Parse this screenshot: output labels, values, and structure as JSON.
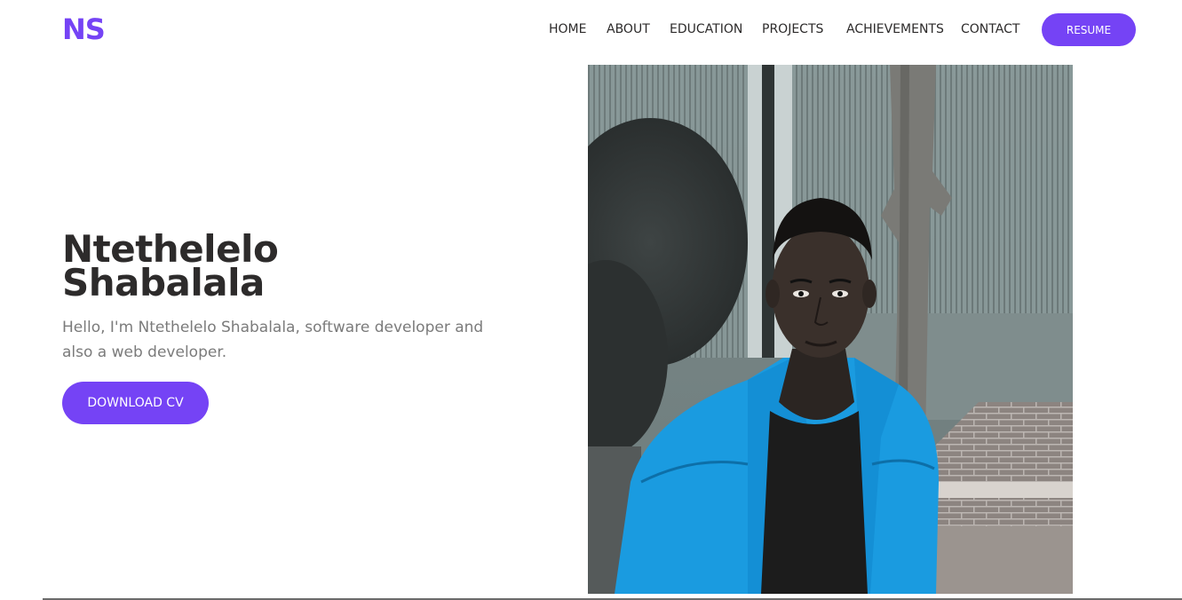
{
  "header": {
    "logo": "NS",
    "nav": [
      "HOME",
      "ABOUT",
      "EDUCATION",
      "PROJECTS",
      "ACHIEVEMENTS",
      "CONTACT"
    ],
    "resume_label": "RESUME"
  },
  "hero": {
    "name_line1": "Ntethelelo",
    "name_line2": "Shabalala",
    "subtitle_line1": "Hello, I'm Ntethelelo Shabalala, software developer and",
    "subtitle_line2": "also a web developer.",
    "download_label": "DOWNLOAD CV"
  },
  "colors": {
    "accent": "#7543f5",
    "heading": "#2d2b2b",
    "subtext": "#7b7b7b",
    "jacket": "#1a9be0"
  }
}
